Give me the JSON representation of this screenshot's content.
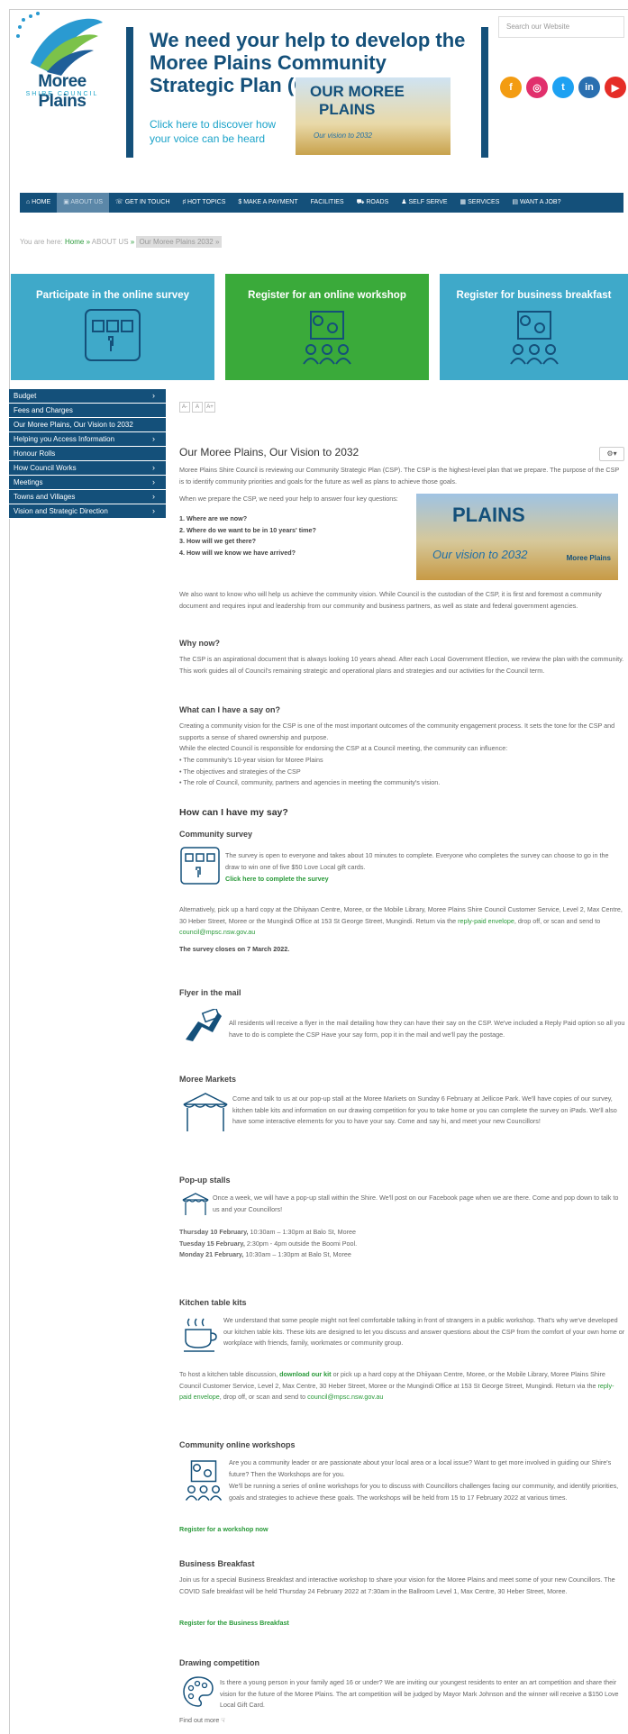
{
  "header": {
    "logo_name": "Moree Plains",
    "logo_sub": "SHIRE COUNCIL",
    "banner_title": "We need your help to develop the Moree Plains Community Strategic Plan (CSP).",
    "banner_link": "Click here to discover how your voice can be heard",
    "banner_img_l1": "OUR MOREE",
    "banner_img_l2": "PLAINS",
    "banner_img_l3": "Our vision to 2032",
    "search_placeholder": "Search our Website",
    "social": [
      {
        "name": "facebook-icon",
        "label": "f",
        "color": "#f39c12"
      },
      {
        "name": "instagram-icon",
        "label": "◎",
        "color": "#e1306c"
      },
      {
        "name": "twitter-icon",
        "label": "t",
        "color": "#1da1f2"
      },
      {
        "name": "linkedin-icon",
        "label": "in",
        "color": "#2a6fb0"
      },
      {
        "name": "youtube-icon",
        "label": "▶",
        "color": "#e52d27"
      }
    ]
  },
  "nav": [
    "⌂ HOME",
    "▣ ABOUT US",
    "☏ GET IN TOUCH",
    "♯ HOT TOPICS",
    "$ MAKE A PAYMENT",
    "FACILITIES",
    "⛟ ROADS",
    "♟ SELF SERVE",
    "▦ SERVICES",
    "▤ WANT A JOB?"
  ],
  "breadcrumb": {
    "prefix": "You are here:",
    "home": "Home",
    "sep": "»",
    "about": "ABOUT US",
    "current": "Our Moree Plains 2032"
  },
  "tiles": [
    {
      "title": "Participate in the online survey",
      "color": "#3fa9c9"
    },
    {
      "title": "Register for an online workshop",
      "color": "#3aaa3a"
    },
    {
      "title": "Register for business breakfast",
      "color": "#3fa9c9"
    }
  ],
  "sidebar": [
    {
      "label": "Budget",
      "chev": "›"
    },
    {
      "label": "Fees and Charges",
      "chev": ""
    },
    {
      "label": "Our Moree Plains, Our Vision to 2032",
      "chev": ""
    },
    {
      "label": "Helping you Access Information",
      "chev": "›"
    },
    {
      "label": "Honour Rolls",
      "chev": ""
    },
    {
      "label": "How Council Works",
      "chev": "›"
    },
    {
      "label": "Meetings",
      "chev": "›"
    },
    {
      "label": "Towns and Villages",
      "chev": "›"
    },
    {
      "label": "Vision and Strategic Direction",
      "chev": "›"
    }
  ],
  "content": {
    "sizer": [
      "A-",
      "A",
      "A+"
    ],
    "title": "Our Moree Plains, Our Vision to 2032",
    "gear": "⚙▾",
    "intro": "Moree Plains Shire Council is reviewing our Community Strategic Plan (CSP). The CSP is the highest-level plan that we prepare. The purpose of the CSP is to identify community priorities and goals for the future as well as plans to achieve those goals.",
    "intro2": "When we prepare the CSP, we need your help to answer four key questions:",
    "questions": [
      "1. Where are we now?",
      "2. Where do we want to be in 10 years' time?",
      "3. How will we get there?",
      "4. How will we know we have arrived?"
    ],
    "img_a": "PLAINS",
    "img_b": "Our vision to 2032",
    "img_c": "Moree Plains",
    "p_help": "We also want to know who will help us achieve the community vision. While Council is the custodian of the CSP, it is first and foremost a community document and requires input and leadership from our community and business partners, as well as state and federal government agencies.",
    "why_h": "Why now?",
    "why_p": "The CSP is an aspirational document that is always looking 10 years ahead. After each Local Government Election, we review the plan with the community. This work guides all of Council's remaining strategic and operational plans and strategies and our activities for the Council term.",
    "say_h": "What can I have a say on?",
    "say_p1": "Creating a community vision for the CSP is one of the most important outcomes of the community engagement process. It sets the tone for the CSP and supports a sense of shared ownership and purpose.",
    "say_p2": "While the elected Council is responsible for endorsing the CSP at a Council meeting, the community can influence:",
    "say_list": [
      "• The community's 10-year vision for Moree Plains",
      "• The objectives and strategies of the CSP",
      "• The role of Council, community, partners and agencies in meeting the community's vision."
    ],
    "how_h": "How can I have my say?",
    "survey_h": "Community survey",
    "survey_p": "The survey is open to everyone and takes about 10 minutes to complete. Everyone who completes the survey can choose to go in the draw to win one of five $50 Love Local gift cards.",
    "survey_link": "Click here to complete the survey",
    "survey_alt": "Alternatively, pick up a hard copy at the Dhiiyaan Centre, Moree, or the Mobile Library, Moree Plains Shire Council Customer Service, Level 2, Max Centre, 30 Heber Street, Moree or the Mungindi Office at 153 St George Street, Mungindi. Return via the",
    "survey_env": "reply-paid envelope",
    "survey_alt2": ", drop off, or scan and send to",
    "survey_email": "council@mpsc.nsw.gov.au",
    "survey_close": "The survey closes on 7 March 2022.",
    "flyer_h": "Flyer in the mail",
    "flyer_p": "All residents will receive a flyer in the mail detailing how they can have their say on the CSP. We've included a Reply Paid option so all you have to do is complete the CSP Have your say form, pop it in the mail and we'll pay the postage.",
    "markets_h": "Moree Markets",
    "markets_p": "Come and talk to us at our pop-up stall at the Moree Markets on Sunday 6 February at Jellicoe Park. We'll have copies of our survey, kitchen table kits and information on our drawing competition for you to take home or you can complete the survey on iPads. We'll also have some interactive elements for you to have your say. Come and say hi, and meet your new Councillors!",
    "popup_h": "Pop-up stalls",
    "popup_p": "Once a week, we will have a pop-up stall within the Shire. We'll post on our Facebook page when we are there. Come and pop down to talk to us and your Councillors!",
    "popup_list": [
      {
        "d": "Thursday 10 February,",
        "t": " 10:30am – 1:30pm at Balo St, Moree"
      },
      {
        "d": "Tuesday 15 February,",
        "t": " 2:30pm - 4pm outside the Boomi Pool."
      },
      {
        "d": "Monday 21 February,",
        "t": " 10:30am – 1:30pm at Balo St, Moree"
      }
    ],
    "kitchen_h": "Kitchen table kits",
    "kitchen_p": "We understand that some people might not feel comfortable talking in front of strangers in a public workshop. That's why we've developed our kitchen table kits. These kits are designed to let you discuss and answer questions about the CSP from the comfort of your own home or workplace with friends, family, workmates or community group.",
    "kitchen_p2a": "To host a kitchen table discussion,",
    "kitchen_kit": "download our kit",
    "kitchen_p2b": "or pick up a hard copy at the Dhiiyaan Centre, Moree, or the Mobile Library, Moree Plains Shire Council Customer Service, Level 2, Max Centre, 30 Heber Street, Moree or the Mungindi Office at 153 St George Street, Mungindi. Return via the",
    "kitchen_env": "reply-paid envelope",
    "kitchen_p2c": ", drop off, or scan and send to",
    "kitchen_email": "council@mpsc.nsw.gov.au",
    "workshop_h": "Community online workshops",
    "workshop_p1": "Are you a community leader or are passionate about your local area or a local issue? Want to get more involved in guiding our Shire's future? Then the Workshops are for you.",
    "workshop_p2": "We'll be running a series of online workshops for you to discuss with Councillors challenges facing our community, and identify priorities, goals and strategies to achieve these goals. The workshops will be held from 15 to 17 February 2022 at various times.",
    "workshop_link": "Register for a workshop now",
    "breakfast_h": "Business Breakfast",
    "breakfast_p": "Join us for a special Business Breakfast and interactive workshop to share your vision for the Moree Plains and meet some of your new Councillors. The COVID Safe breakfast will be held Thursday 24 February 2022 at 7:30am in the Ballroom Level 1, Max Centre, 30 Heber Street, Moree.",
    "breakfast_link": "Register for the Business Breakfast",
    "drawing_h": "Drawing competition",
    "drawing_p": "Is there a young person in your family aged 16 or under? We are inviting our youngest residents to enter an art competition and share their vision for the future of the Moree Plains. The art competition will be judged by Mayor Mark Johnson and the winner will receive a $150 Love Local Gift Card.",
    "drawing_more": "Find out more ☟"
  }
}
